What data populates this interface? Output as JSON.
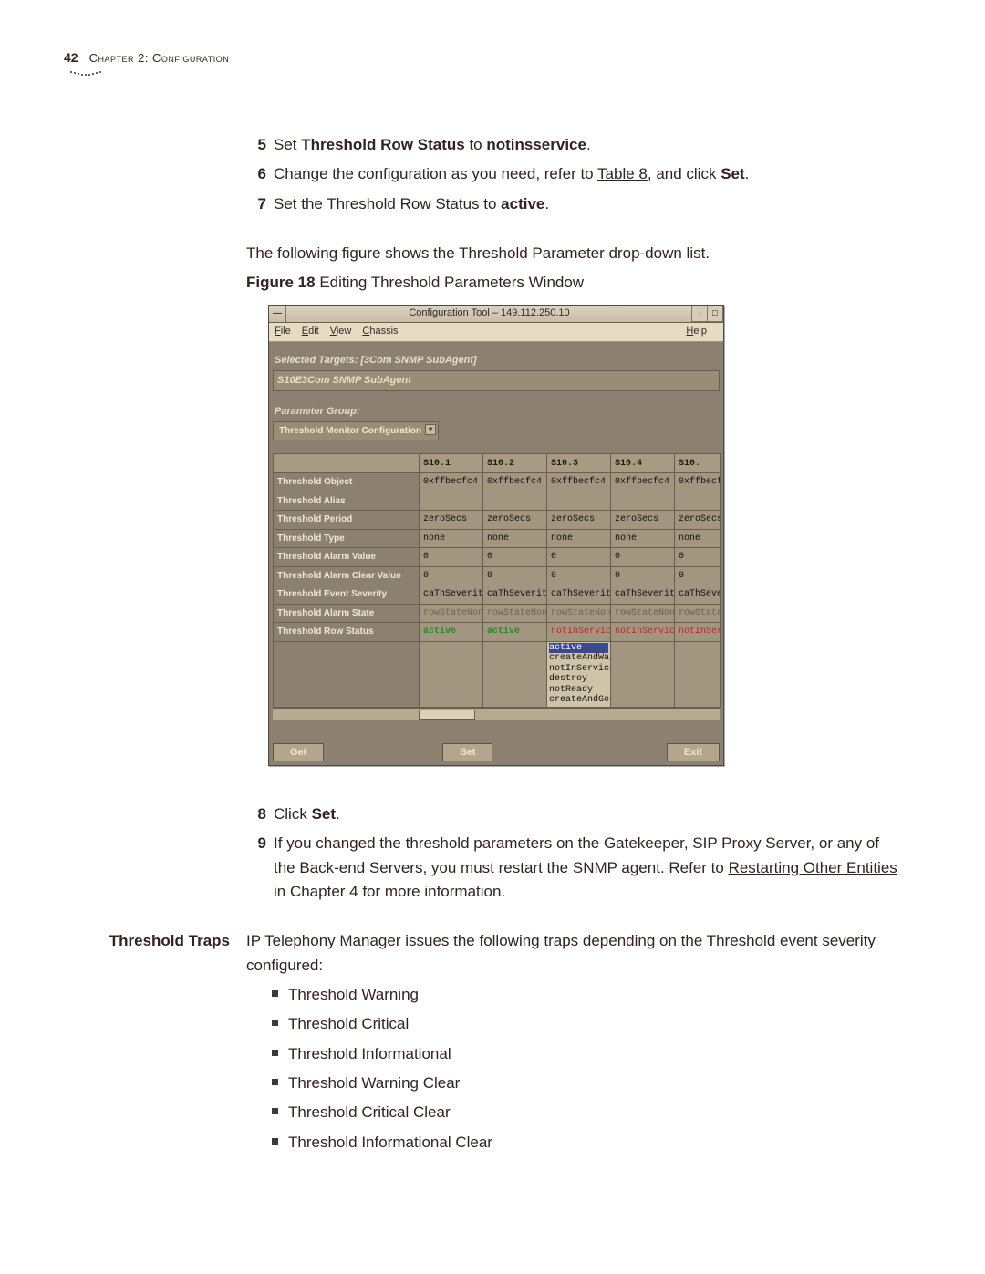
{
  "page": {
    "number": "42",
    "chapter": "Chapter 2: Configuration"
  },
  "steps_a": [
    {
      "n": "5",
      "html": "Set <b>Threshold Row Status</b> to <b>notinsservice</b>."
    },
    {
      "n": "6",
      "html": "Change the configuration as you need, refer to <u>Table 8</u>, and click <b>Set</b>."
    },
    {
      "n": "7",
      "html": "Set the Threshold Row Status to <b>active</b>."
    }
  ],
  "pre_fig_para": "The following figure shows the Threshold Parameter drop-down list.",
  "fig_caption_prefix": "Figure 18",
  "fig_caption_text": "  Editing Threshold Parameters Window",
  "screenshot": {
    "title": "Configuration Tool – 149.112.250.10",
    "menus": {
      "file": "File",
      "edit": "Edit",
      "view": "View",
      "chassis": "Chassis",
      "help": "Help"
    },
    "selected_targets_label": "Selected Targets:  [3Com SNMP SubAgent]",
    "subagent_box": "S10E3Com SNMP SubAgent",
    "param_group_label": "Parameter Group:",
    "param_group_value": "Threshold Monitor Configuration",
    "columns": [
      "S10.1",
      "S10.2",
      "S10.3",
      "S10.4",
      "S10."
    ],
    "rows": [
      {
        "label": "Threshold Object",
        "cells": [
          "0xffbecfc4",
          "0xffbecfc4",
          "0xffbecfc4",
          "0xffbecfc4",
          "0xffbecf"
        ],
        "style": "cell"
      },
      {
        "label": "Threshold Alias",
        "cells": [
          "",
          "",
          "",
          "",
          ""
        ],
        "style": "cell"
      },
      {
        "label": "Threshold Period",
        "cells": [
          "zeroSecs",
          "zeroSecs",
          "zeroSecs",
          "zeroSecs",
          "zeroSecs"
        ],
        "style": "cell"
      },
      {
        "label": "Threshold Type",
        "cells": [
          "none",
          "none",
          "none",
          "none",
          "none"
        ],
        "style": "cell"
      },
      {
        "label": "Threshold Alarm Value",
        "cells": [
          "0",
          "0",
          "0",
          "0",
          "0"
        ],
        "style": "cell"
      },
      {
        "label": "Threshold Alarm Clear Value",
        "cells": [
          "0",
          "0",
          "0",
          "0",
          "0"
        ],
        "style": "cell"
      },
      {
        "label": "Threshold Event Severity",
        "cells": [
          "caThSeverity",
          "caThSeverity",
          "caThSeverity",
          "caThSeverity",
          "caThSeve"
        ],
        "style": "cell"
      },
      {
        "label": "Threshold Alarm State",
        "cells": [
          "rowStateNone",
          "rowStateNone",
          "rowStateNone",
          "rowStateNone",
          "rowState"
        ],
        "style": "dim"
      },
      {
        "label": "Threshold Row Status",
        "cells": [
          "active",
          "active",
          "notInService",
          "notInService",
          "notInSer"
        ],
        "style": "mixed"
      }
    ],
    "dropdown_options": [
      "active",
      "createAndWa",
      "notInService",
      "destroy",
      "notReady",
      "createAndGo"
    ],
    "buttons": {
      "get": "Get",
      "set": "Set",
      "exit": "Exit"
    }
  },
  "steps_b": [
    {
      "n": "8",
      "html": "Click <b>Set</b>."
    },
    {
      "n": "9",
      "html": "If you changed the threshold parameters on the Gatekeeper, SIP Proxy Server, or any of the Back-end Servers, you must restart the SNMP agent. Refer to <u>Restarting Other Entities</u> in Chapter 4 for more information."
    }
  ],
  "section2": {
    "side_head": "Threshold Traps",
    "intro": "IP Telephony Manager issues the following traps depending on the Threshold event severity configured:",
    "bullets": [
      "Threshold Warning",
      "Threshold Critical",
      "Threshold Informational",
      "Threshold Warning Clear",
      "Threshold Critical Clear",
      "Threshold Informational Clear"
    ]
  }
}
